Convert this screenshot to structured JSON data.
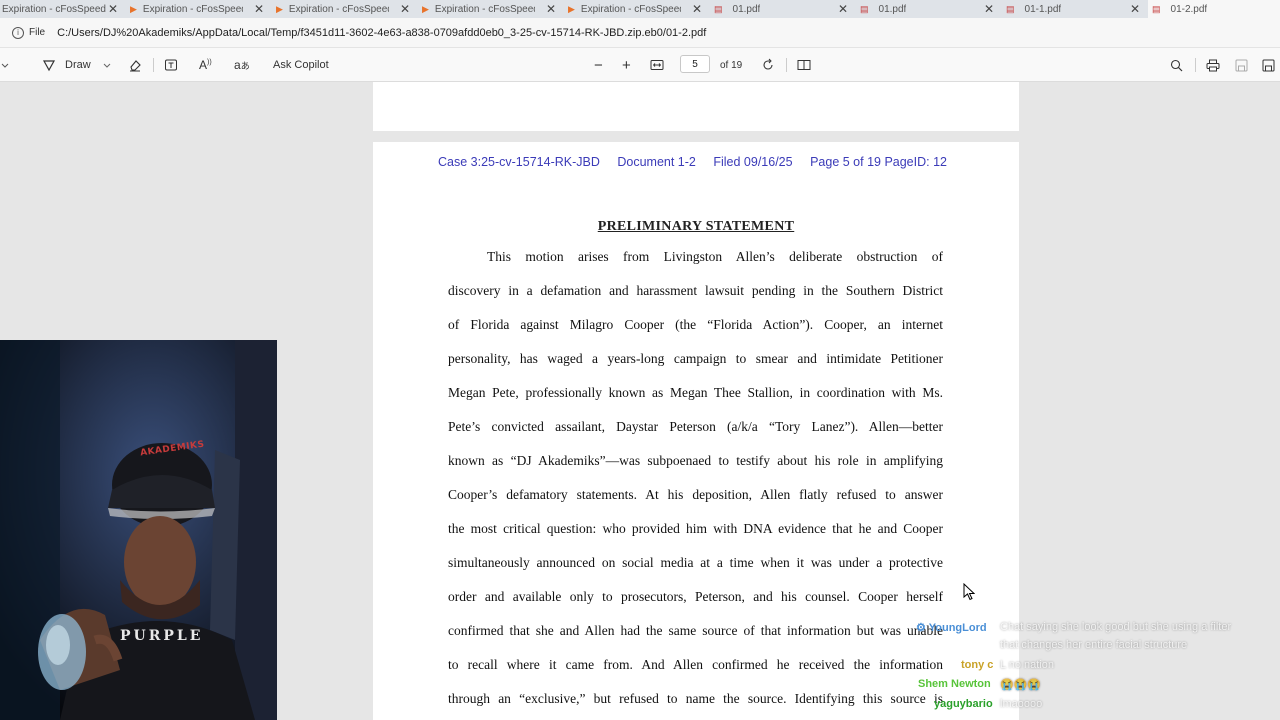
{
  "tabs": [
    {
      "label": "Expiration - cFosSpeed",
      "icon": "play-icon",
      "active": false
    },
    {
      "label": "Expiration - cFosSpeed",
      "icon": "play-icon",
      "active": false
    },
    {
      "label": "Expiration - cFosSpeed",
      "icon": "play-icon",
      "active": false
    },
    {
      "label": "Expiration - cFosSpeed",
      "icon": "play-icon",
      "active": false
    },
    {
      "label": "Expiration - cFosSpeed",
      "icon": "play-icon",
      "active": false
    },
    {
      "label": "01.pdf",
      "icon": "pdf-icon",
      "active": false
    },
    {
      "label": "01.pdf",
      "icon": "pdf-icon",
      "active": false
    },
    {
      "label": "01-1.pdf",
      "icon": "pdf-icon",
      "active": false
    },
    {
      "label": "01-2.pdf",
      "icon": "pdf-icon",
      "active": true
    }
  ],
  "address": {
    "scheme_label": "File",
    "url": "C:/Users/DJ%20Akademiks/AppData/Local/Temp/f3451d11-3602-4e63-a838-0709afdd0eb0_3-25-cv-15714-RK-JBD.zip.eb0/01-2.pdf"
  },
  "toolbar": {
    "draw_label": "Draw",
    "copilot_label": "Ask Copilot",
    "current_page": "5",
    "page_total_label": "of 19"
  },
  "document": {
    "header": {
      "case": "Case 3:25-cv-15714-RK-JBD",
      "document": "Document 1-2",
      "filed": "Filed 09/16/25",
      "page": "Page 5 of 19 PageID: 12"
    },
    "title": "PRELIMINARY STATEMENT",
    "lines": [
      "This motion arises from Livingston Allen’s deliberate obstruction of",
      "discovery in a defamation and harassment lawsuit pending in the Southern District",
      "of Florida against Milagro Cooper (the “Florida Action”).  Cooper, an internet",
      "personality, has waged a years-long campaign to smear and intimidate Petitioner",
      "Megan Pete, professionally known as Megan Thee Stallion, in coordination with Ms.",
      "Pete’s convicted assailant, Daystar Peterson (a/k/a “Tory Lanez”).  Allen—better",
      "known as “DJ Akademiks”—was subpoenaed to testify about his role in amplifying",
      "Cooper’s defamatory statements.  At his deposition, Allen flatly refused to answer",
      "the most critical question:  who provided him with DNA evidence that he and Cooper",
      "simultaneously announced on social media at a time when it was under a protective",
      "order and available only to prosecutors, Peterson, and his counsel.  Cooper herself",
      "confirmed that she and Allen had the same source of that information but was unable",
      "to recall where it came from.  And Allen confirmed he received the information",
      "through an “exclusive,” but refused to name the source.  Identifying this source is"
    ]
  },
  "webcam": {
    "cap_text": "AKADEMIKS",
    "shirt_text": "PURPLE"
  },
  "chat": [
    {
      "user": "YoungLord",
      "message": "Chat saying she look good but she using a filter",
      "message2": "that changes her entire facial structure",
      "user_color": "#4a8fd6"
    },
    {
      "user": "tony c",
      "message": "L no nation",
      "message2": "",
      "user_color": "#c9a227"
    },
    {
      "user": "Shem Newton",
      "message": "😭😭😭",
      "message2": "",
      "user_color": "#58c43a"
    },
    {
      "user": "yaguybario",
      "message": "lmaoooo",
      "message2": "",
      "user_color": "#2aa02a"
    }
  ],
  "colors": {
    "header_text": "#3b3bb8",
    "page_bg": "#ffffff",
    "viewer_bg": "#e6e6e6"
  }
}
